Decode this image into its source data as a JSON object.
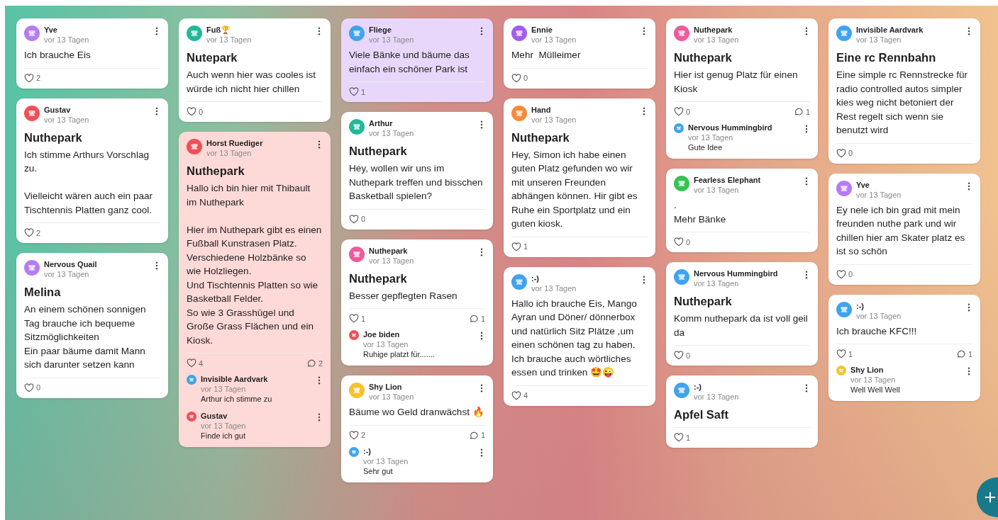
{
  "columns": [
    {
      "posts": [
        {
          "author": "Yve",
          "time": "vor 13 Tagen",
          "color": "#b57cf2",
          "body": "Ich brauche Eis",
          "likes": "2"
        },
        {
          "author": "Gustav",
          "time": "vor 13 Tagen",
          "color": "#ef4f55",
          "title": "Nuthepark",
          "body": "Ich stimme Arthurs Vorschlag zu.\n\nVielleicht wären auch ein paar Tischtennis Platten ganz cool.",
          "likes": "2"
        },
        {
          "author": "Nervous Quail",
          "time": "vor 13 Tagen",
          "color": "#b57cf2",
          "title": "Melina",
          "body": "An einem schönen sonnigen Tag brauche ich bequeme Sitzmöglichkeiten\nEin paar bäume damit Mann sich darunter setzen kann",
          "likes": "0"
        }
      ]
    },
    {
      "posts": [
        {
          "author": "Fuß🏆",
          "time": "vor 13 Tagen",
          "color": "#22b89a",
          "title": "Nutepark",
          "body": "Auch wenn hier was cooles ist würde ich nicht hier chillen",
          "likes": "0"
        },
        {
          "author": "Horst Ruediger",
          "time": "vor 13 Tagen",
          "color": "#ef4f55",
          "background": {
            "color": "#fdd9d7"
          },
          "title": "Nuthepark",
          "body": "Hallo ich bin hier mit Thibault im Nuthepark\n\nHier im Nuthepark gibt es einen Fußball Kunstrasen Platz. Verschiedene Holzbänke so wie Holzliegen.\nUnd Tischtennis Platten so wie Basketball Felder.\nSo wie 3 Grasshügel und Große Grass Flächen und ein Kiosk.",
          "likes": "4",
          "comment_count": "2",
          "comments": [
            {
              "author": "Invisible Aardvark",
              "time": "vor 13 Tagen",
              "color": "#3fa3ee",
              "text": "Arthur ich stimme zu"
            },
            {
              "author": "Gustav",
              "time": "vor 13 Tagen",
              "color": "#ef4f55",
              "text": "Finde ich gut"
            }
          ]
        }
      ]
    },
    {
      "posts": [
        {
          "author": "Fliege",
          "time": "vor 13 Tagen",
          "color": "#3fa3ee",
          "background": {
            "color": "#e9d7fb"
          },
          "body": "Viele Bänke und bäume das einfach ein schöner Park ist",
          "likes": "1"
        },
        {
          "author": "Arthur",
          "time": "vor 13 Tagen",
          "color": "#22b89a",
          "title": "Nuthepark",
          "body": "Hey, wollen wir uns im Nuthepark treffen und bisschen Basketball spielen?",
          "likes": "0"
        },
        {
          "author": "Nuthepark",
          "time": "vor 13 Tagen",
          "color": "#ee5a9c",
          "title": "Nuthepark",
          "body": "Besser gepflegten Rasen",
          "likes": "1",
          "comment_count": "1",
          "comments": [
            {
              "author": "Joe biden",
              "time": "vor 13 Tagen",
              "color": "#ef4f55",
              "text": "Ruhige platzt für......."
            }
          ]
        },
        {
          "author": "Shy Lion",
          "time": "vor 13 Tagen",
          "color": "#f5c22e",
          "body": "Bäume wo Geld dranwächst 🔥",
          "likes": "2",
          "comment_count": "1",
          "comments": [
            {
              "author": ":-)",
              "time": "vor 13 Tagen",
              "color": "#3fa3ee",
              "text": "Sehr gut"
            }
          ]
        }
      ]
    },
    {
      "posts": [
        {
          "author": "Ennie",
          "time": "vor 13 Tagen",
          "color": "#a35cf0",
          "body": "Mehr  Mülleimer",
          "likes": "0"
        },
        {
          "author": "Hand",
          "time": "vor 13 Tagen",
          "color": "#f78a3a",
          "title": "Nuthepark",
          "body": "Hey, Simon ich habe einen guten Platz gefunden wo wir mit unseren Freunden abhängen können. Hir gibt es Ruhe ein Sportplatz und ein guten kiosk.",
          "likes": "1"
        },
        {
          "author": ":-)",
          "time": "vor 13 Tagen",
          "color": "#3fa3ee",
          "body": "Hallo ich brauche Eis, Mango Ayran und Döner/ dönnerbox und natürlich Sitz Plätze ,um einen schönen tag zu haben. Ich brauche auch wörtliches essen und trinken 🤩😜",
          "likes": "4"
        }
      ]
    },
    {
      "posts": [
        {
          "author": "Nuthepark",
          "time": "vor 13 Tagen",
          "color": "#ee5a9c",
          "title": "Nuthepark",
          "body": "Hier ist genug Platz für einen Kiosk",
          "likes": "0",
          "comment_count": "1",
          "comments": [
            {
              "author": "Nervous Hummingbird",
              "time": "vor 13 Tagen",
              "color": "#3fa3ee",
              "text": "Gute Idee"
            }
          ]
        },
        {
          "author": "Fearless Elephant",
          "time": "vor 13 Tagen",
          "color": "#35c252",
          "body": ".\nMehr Bänke",
          "likes": "0"
        },
        {
          "author": "Nervous Hummingbird",
          "time": "vor 13 Tagen",
          "color": "#3fa3ee",
          "title": "Nuthepark",
          "body": "Komm nuthepark da ist voll geil da",
          "likes": "0"
        },
        {
          "author": ":-)",
          "time": "vor 13 Tagen",
          "color": "#3fa3ee",
          "title": "Apfel Saft",
          "likes": "1"
        }
      ]
    },
    {
      "posts": [
        {
          "author": "Invisible Aardvark",
          "time": "vor 13 Tagen",
          "color": "#3fa3ee",
          "title": "Eine rc Rennbahn",
          "body": "Eine simple rc Rennstrecke für radio controlled autos simpler kies weg nicht betoniert der Rest regelt sich wenn sie benutzt wird",
          "likes": "0"
        },
        {
          "author": "Yve",
          "time": "vor 13 Tagen",
          "color": "#b57cf2",
          "body": "Ey nele ich bin grad mit mein freunden nuthe park und wir chillen hier am Skater platz es ist so schön",
          "likes": "0"
        },
        {
          "author": ":-)",
          "time": "vor 13 Tagen",
          "color": "#3fa3ee",
          "body": "Ich brauche KFC!!!",
          "likes": "1",
          "comment_count": "1",
          "comments": [
            {
              "author": "Shy Lion",
              "time": "vor 13 Tagen",
              "color": "#f5c22e",
              "text": "Well Well Well"
            }
          ]
        }
      ]
    }
  ]
}
